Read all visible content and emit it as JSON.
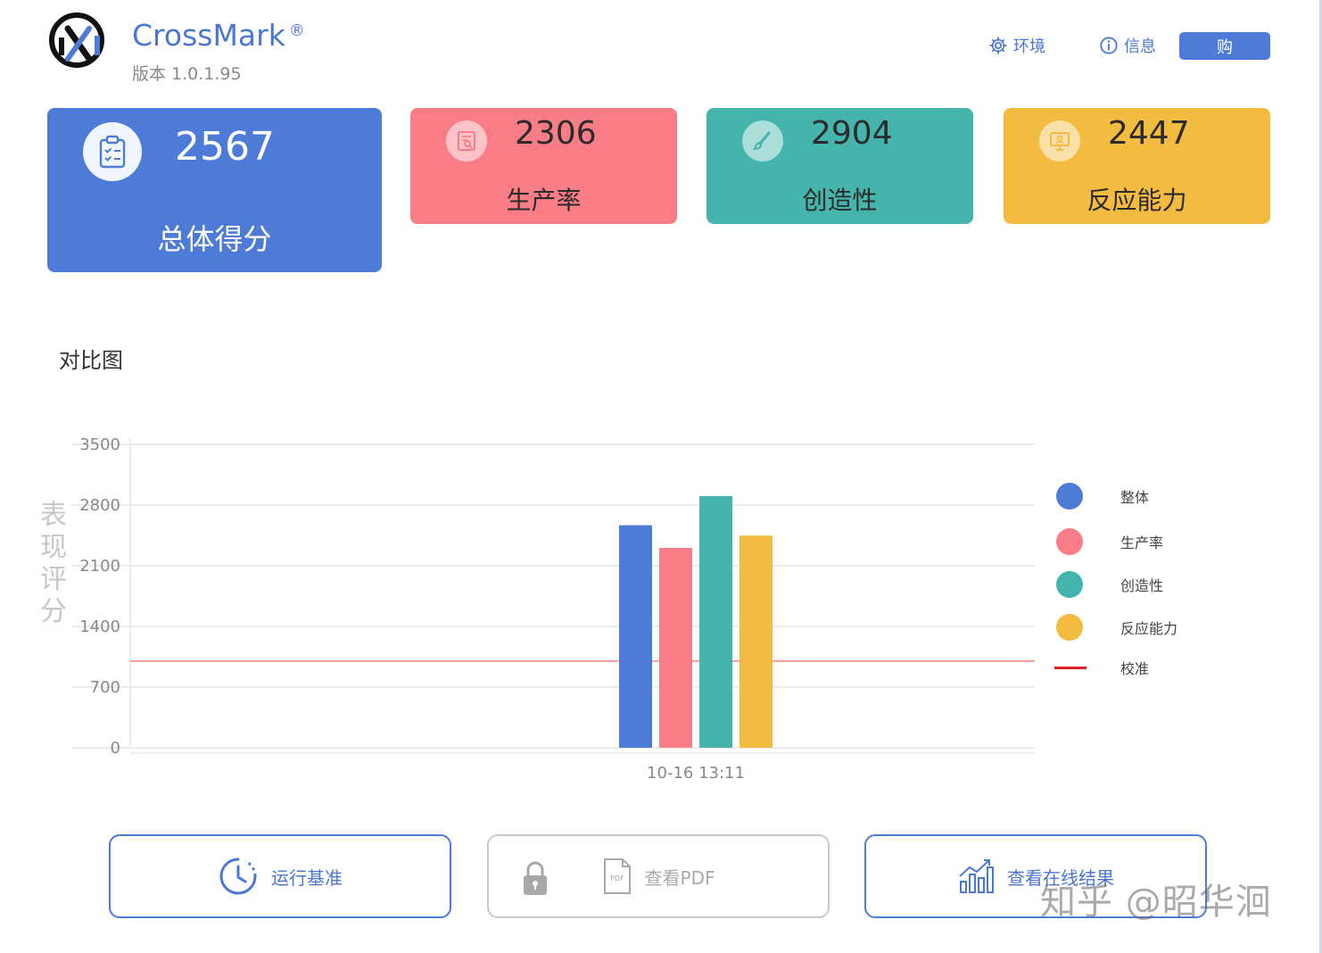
{
  "app": {
    "name": "CrossMark",
    "reg_mark": "®",
    "version": "版本 1.0.1.95"
  },
  "header": {
    "settings_label": "环境",
    "info_label": "信息",
    "buy_label": "购"
  },
  "cards": {
    "total": {
      "score": "2567",
      "label": "总体得分",
      "icon": "clipboard-icon"
    },
    "productivity": {
      "score": "2306",
      "label": "生产率",
      "icon": "document-search-icon"
    },
    "creativity": {
      "score": "2904",
      "label": "创造性",
      "icon": "brush-icon"
    },
    "responsiveness": {
      "score": "2447",
      "label": "反应能力",
      "icon": "presentation-icon"
    }
  },
  "chart_section": {
    "title": "对比图"
  },
  "chart_data": {
    "type": "bar",
    "ylabel": "表现评分",
    "ylim": [
      0,
      3500
    ],
    "yticks": [
      0,
      700,
      1400,
      2100,
      2800,
      3500
    ],
    "categories": [
      "10-16 13:11"
    ],
    "series": [
      {
        "name": "整体",
        "values": [
          2567
        ],
        "color": "#4f7bd8"
      },
      {
        "name": "生产率",
        "values": [
          2306
        ],
        "color": "#f97d87"
      },
      {
        "name": "创造性",
        "values": [
          2904
        ],
        "color": "#45b4ac"
      },
      {
        "name": "反应能力",
        "values": [
          2447
        ],
        "color": "#f3bc41"
      }
    ],
    "reference_line": {
      "name": "校准",
      "value": 1000,
      "color": "#e02020"
    },
    "grid": true,
    "legend_position": "right"
  },
  "actions": {
    "run": "运行基准",
    "pdf": "查看PDF",
    "online": "查看在线结果"
  },
  "watermark": "知乎 @昭华洄"
}
